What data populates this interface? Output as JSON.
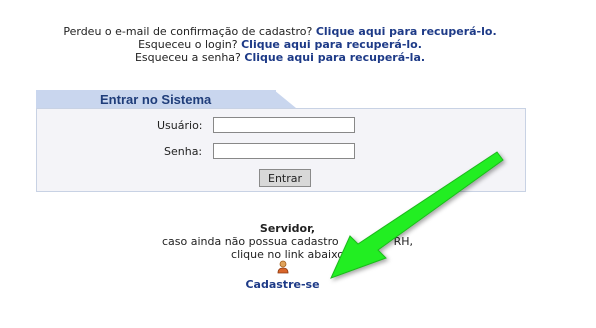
{
  "recovery": {
    "lines": [
      {
        "text": "Perdeu o e-mail de confirmação de cadastro? ",
        "link": "Clique aqui para recuperá-lo."
      },
      {
        "text": "Esqueceu o login? ",
        "link": "Clique aqui para recuperá-lo."
      },
      {
        "text": "Esqueceu a senha? ",
        "link": "Clique aqui para recuperá-la."
      }
    ]
  },
  "login": {
    "title": "Entrar no Sistema",
    "user_label": "Usuário:",
    "user_value": "",
    "password_label": "Senha:",
    "password_value": "",
    "submit_label": "Entrar"
  },
  "register": {
    "heading": "Servidor,",
    "line1": "caso ainda não possua cadastro",
    "line1_suffix": "RH,",
    "line2": "clique no link abaixo",
    "link": "Cadastre-se"
  },
  "colors": {
    "link": "#1d3a87",
    "tab": "#c9d6ee",
    "arrow": "#22ee22"
  },
  "icons": [
    "user-icon",
    "arrow-annotation"
  ]
}
